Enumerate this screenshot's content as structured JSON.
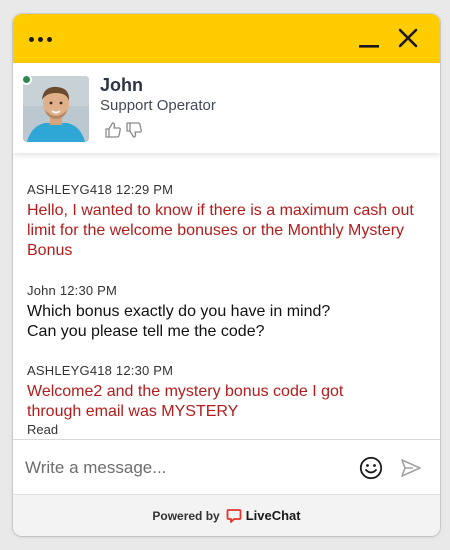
{
  "window": {
    "accent_color": "#ffcc00",
    "menu_icon": "more-horizontal-icon",
    "minimize_icon": "minimize-icon",
    "close_icon": "close-icon"
  },
  "agent": {
    "name": "John",
    "role": "Support Operator",
    "status": "online",
    "status_color": "#2d8a4e",
    "rate_up_icon": "thumbs-up-icon",
    "rate_down_icon": "thumbs-down-icon"
  },
  "messages": [
    {
      "author": "ASHLEYG418",
      "time": "12:29 PM",
      "text": "Hello, I wanted to know if there is a maximum cash out limit for the welcome bonuses or the Monthly Mystery Bonus",
      "sender": "visitor"
    },
    {
      "author": "John",
      "time": "12:30 PM",
      "text": "Which bonus exactly do you have in mind? Can you please tell me the code?",
      "sender": "agent"
    },
    {
      "author": "ASHLEYG418",
      "time": "12:30 PM",
      "text": "Welcome2 and the mystery bonus code I got through email was MYSTERY",
      "sender": "visitor",
      "status": "Read"
    }
  ],
  "composer": {
    "placeholder": "Write a message...",
    "value": "",
    "emoji_icon": "emoji-icon",
    "send_icon": "send-icon"
  },
  "footer": {
    "powered_by": "Powered by",
    "brand": "LiveChat",
    "brand_color": "#e3352b"
  },
  "colors": {
    "visitor_text": "#b41c1c",
    "agent_text": "#111111"
  }
}
